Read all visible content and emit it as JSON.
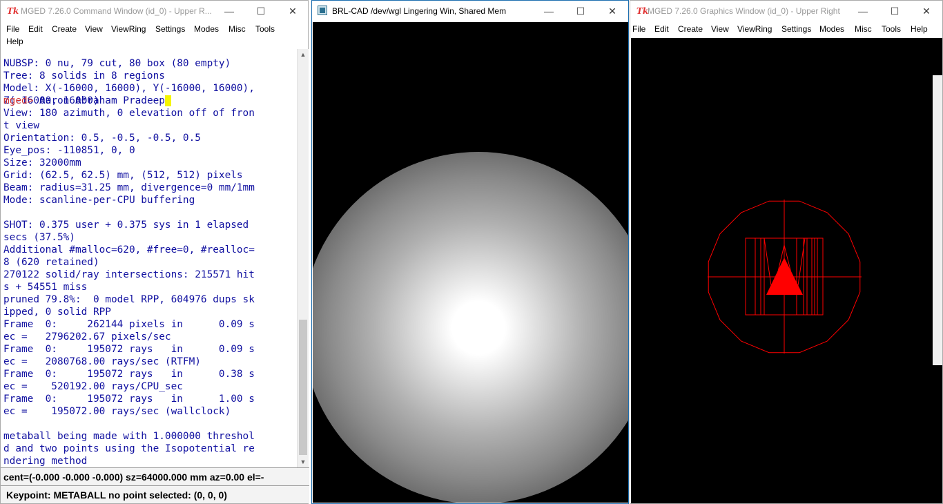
{
  "command_window": {
    "title": "MGED 7.26.0 Command Window (id_0) - Upper R...",
    "tk_icon": "Tk",
    "menu": [
      "File",
      "Edit",
      "Create",
      "View",
      "ViewRing",
      "Settings",
      "Modes",
      "Misc",
      "Tools",
      "Help"
    ],
    "console_lines": [
      "NUBSP: 0 nu, 79 cut, 80 box (80 empty)",
      "Tree: 8 solids in 8 regions",
      "Model: X(-16000, 16000), Y(-16000, 16000),",
      "Z(-16000, 16000)",
      "View: 180 azimuth, 0 elevation off of fron",
      "t view",
      "Orientation: 0.5, -0.5, -0.5, 0.5",
      "Eye_pos: -110851, 0, 0",
      "Size: 32000mm",
      "Grid: (62.5, 62.5) mm, (512, 512) pixels",
      "Beam: radius=31.25 mm, divergence=0 mm/1mm",
      "Mode: scanline-per-CPU buffering",
      "",
      "SHOT: 0.375 user + 0.375 sys in 1 elapsed",
      "secs (37.5%)",
      "Additional #malloc=620, #free=0, #realloc=",
      "8 (620 retained)",
      "270122 solid/ray intersections: 215571 hit",
      "s + 54551 miss",
      "pruned 79.8%:  0 model RPP, 604976 dups sk",
      "ipped, 0 solid RPP",
      "Frame  0:     262144 pixels in      0.09 s",
      "ec =   2796202.67 pixels/sec",
      "Frame  0:     195072 rays   in      0.09 s",
      "ec =   2080768.00 rays/sec (RTFM)",
      "Frame  0:     195072 rays   in      0.38 s",
      "ec =    520192.00 rays/CPU_sec",
      "Frame  0:     195072 rays   in      1.00 s",
      "ec =    195072.00 rays/sec (wallclock)",
      "",
      "metaball being made with 1.000000 threshol",
      "d and two points using the Isopotential re",
      "ndering method"
    ],
    "prompt": "mged>",
    "input_text": " Aaron Abraham Pradeep",
    "status_line": "cent=(-0.000 -0.000 -0.000) sz=64000.000  mm  az=0.00  el=-",
    "keypoint_line": "Keypoint: METABALL no point selected: (0, 0, 0)"
  },
  "raytrace_window": {
    "title": "BRL-CAD /dev/wgl Lingering Win, Shared Mem"
  },
  "graphics_window": {
    "title": "MGED 7.26.0 Graphics Window (id_0) - Upper Right",
    "tk_icon": "Tk",
    "menu": [
      "File",
      "Edit",
      "Create",
      "View",
      "ViewRing",
      "Settings",
      "Modes",
      "Misc",
      "Tools",
      "Help"
    ]
  },
  "window_controls": {
    "minimize": "—",
    "maximize": "☐",
    "close": "✕"
  },
  "colors": {
    "console_text": "#1010a0",
    "prompt": "#d03030",
    "wireframe": "#ff0000",
    "cursor": "#f5f500"
  }
}
